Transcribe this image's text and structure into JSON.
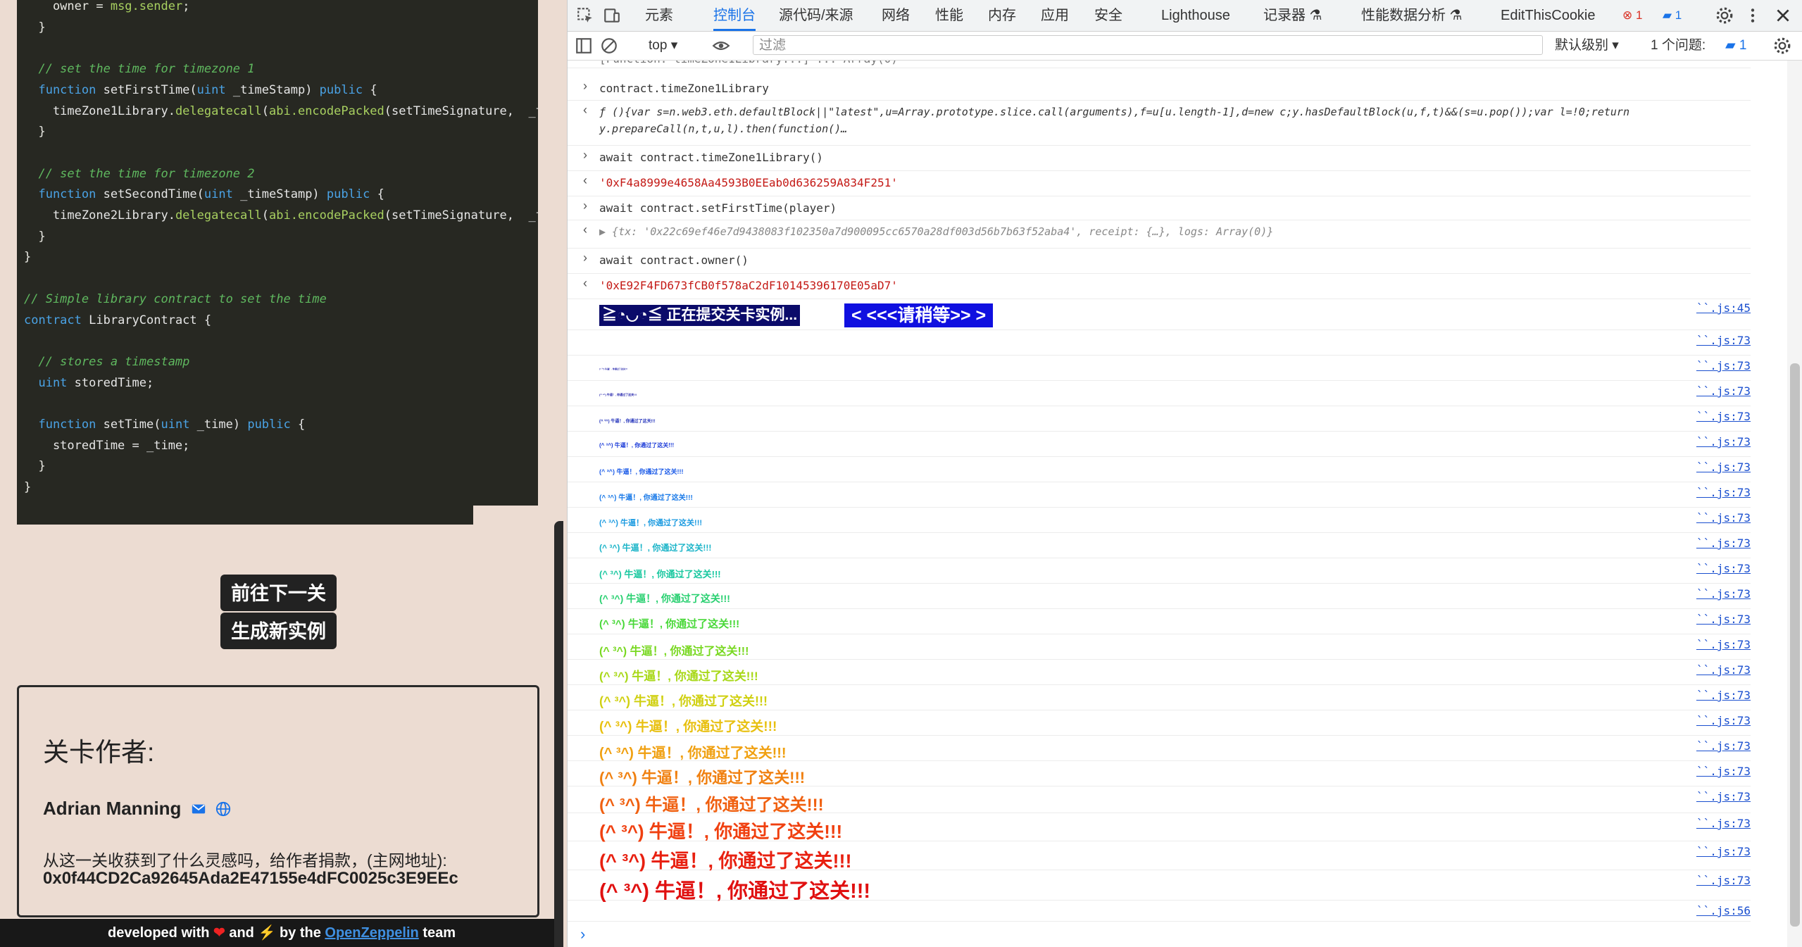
{
  "code_lines": [
    [
      [
        "",
        "    owner = "
      ],
      [
        "call",
        "msg.sender"
      ],
      [
        "",
        ";"
      ]
    ],
    [
      [
        "",
        "  }"
      ]
    ],
    [
      [
        "",
        ""
      ]
    ],
    [
      [
        "cm",
        "  // set the time for timezone 1"
      ]
    ],
    [
      [
        "kw",
        "  function "
      ],
      [
        "fn",
        "setFirstTime("
      ],
      [
        "kw",
        "uint"
      ],
      [
        "fn",
        " _timeStamp) "
      ],
      [
        "kw",
        "public"
      ],
      [
        "fn",
        " {"
      ]
    ],
    [
      [
        "fn",
        "    timeZone1Library."
      ],
      [
        "call",
        "delegatecall"
      ],
      [
        "fn",
        "("
      ],
      [
        "call",
        "abi.encodePacked"
      ],
      [
        "fn",
        "(setTimeSignature,  _time"
      ]
    ],
    [
      [
        "",
        "  }"
      ]
    ],
    [
      [
        "",
        ""
      ]
    ],
    [
      [
        "cm",
        "  // set the time for timezone 2"
      ]
    ],
    [
      [
        "kw",
        "  function "
      ],
      [
        "fn",
        "setSecondTime("
      ],
      [
        "kw",
        "uint"
      ],
      [
        "fn",
        " _timeStamp) "
      ],
      [
        "kw",
        "public"
      ],
      [
        "fn",
        " {"
      ]
    ],
    [
      [
        "fn",
        "    timeZone2Library."
      ],
      [
        "call",
        "delegatecall"
      ],
      [
        "fn",
        "("
      ],
      [
        "call",
        "abi.encodePacked"
      ],
      [
        "fn",
        "(setTimeSignature,  _time"
      ]
    ],
    [
      [
        "",
        "  }"
      ]
    ],
    [
      [
        "",
        "}"
      ]
    ],
    [
      [
        "",
        ""
      ]
    ],
    [
      [
        "cm",
        "// Simple library contract to set the time"
      ]
    ],
    [
      [
        "kw",
        "contract "
      ],
      [
        "fn",
        "LibraryContract {"
      ]
    ],
    [
      [
        "",
        ""
      ]
    ],
    [
      [
        "cm",
        "  // stores a timestamp"
      ]
    ],
    [
      [
        "kw",
        "  uint "
      ],
      [
        "fn",
        "storedTime;"
      ]
    ],
    [
      [
        "",
        ""
      ]
    ],
    [
      [
        "kw",
        "  function "
      ],
      [
        "fn",
        "setTime("
      ],
      [
        "kw",
        "uint"
      ],
      [
        "fn",
        " _time) "
      ],
      [
        "kw",
        "public"
      ],
      [
        "fn",
        " {"
      ]
    ],
    [
      [
        "fn",
        "    storedTime = _time;"
      ]
    ],
    [
      [
        "",
        "  }"
      ]
    ],
    [
      [
        "",
        "}"
      ]
    ]
  ],
  "buttons": {
    "next_level": "前往下一关",
    "new_instance": "生成新实例"
  },
  "author": {
    "title": "关卡作者:",
    "name": "Adrian Manning",
    "donate_text": "从这一关收获到了什么灵感吗，给作者捐款，(主网地址):",
    "address": "0x0f44CD2Ca92645Ada2E47155e4dFC0025c3E9EEc"
  },
  "footer": {
    "prefix": "developed with",
    "heart": "❤",
    "and": "and",
    "bolt": "⚡",
    "by": "by the",
    "link": "OpenZeppelin",
    "team": "team"
  },
  "devtools": {
    "tabs": [
      "元素",
      "控制台",
      "源代码/来源",
      "网络",
      "性能",
      "内存",
      "应用",
      "安全",
      "Lighthouse",
      "记录器 ⚗",
      "性能数据分析 ⚗",
      "EditThisCookie"
    ],
    "active_tab": "控制台",
    "error_count": "1",
    "msg_count": "1",
    "context": "top",
    "filter_placeholder": "过滤",
    "levels": "默认级别",
    "issues": "1 个问题:",
    "issues_count": "1",
    "clipped_top_line": "[Function: timeZone1Library...] ... Array(0)",
    "entries": [
      {
        "type": "input",
        "text": "contract.timeZone1Library"
      },
      {
        "type": "output",
        "text": "ƒ (){var s=n.web3.eth.defaultBlock||\"latest\",u=Array.prototype.slice.call(arguments),f=u[u.length-1],d=new c;y.hasDefaultBlock(u,f,t)&&(s=u.pop());var l=!0;return",
        "text2": "y.prepareCall(n,t,u,l).then(function()…"
      },
      {
        "type": "input",
        "text": "await contract.timeZone1Library()"
      },
      {
        "type": "output_str",
        "text": "'0xF4a8999e4658Aa4593B0EEab0d636259A834F251'"
      },
      {
        "type": "input",
        "text": "await contract.setFirstTime(player)"
      },
      {
        "type": "output_obj",
        "text": "▶ {tx: '0x22c69ef46e7d9438083f102350a7d900095cc6570a28df003d56b7b63f52aba4', receipt: {…}, logs: Array(0)}"
      },
      {
        "type": "input",
        "text": "await contract.owner()"
      },
      {
        "type": "output_str",
        "text": "'0xE92F4FD673fCB0f578aC2dF10145396170E05aD7'"
      }
    ],
    "submit_banner_left": "≧◔◡◔≦ 正在提交关卡实例...",
    "submit_banner_right": "< <<<请稍等>> >",
    "success_text": "(^ ³^) 牛逼！, 你通过了这关!!!",
    "src_main": "``.js:45",
    "src_repeat": "``.js:73",
    "src_last": "``.js:56",
    "prompt": "›",
    "rainbow_colors": [
      "#1a1aa8",
      "#1a1aa8",
      "#1a1aa8",
      "#1a2ab8",
      "#1a3ad8",
      "#1a5ae8",
      "#1a7ae8",
      "#1a9ae0",
      "#1ab4c8",
      "#1ac8a0",
      "#28d070",
      "#48d838",
      "#78d820",
      "#a8d818",
      "#d0d010",
      "#e8c010",
      "#f0a010",
      "#f08010",
      "#f06010",
      "#f04010",
      "#e82010",
      "#e01010"
    ],
    "rainbow_sizes": [
      3,
      3,
      4,
      6,
      8,
      9,
      10,
      11,
      12,
      13,
      14,
      15,
      16,
      17,
      18,
      19,
      20,
      22,
      24,
      26,
      27,
      29
    ]
  }
}
